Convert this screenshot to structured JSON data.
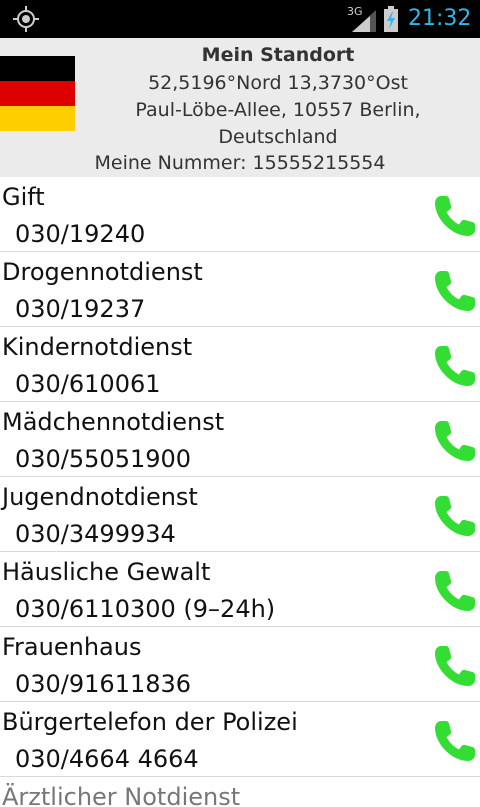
{
  "status_bar": {
    "network": "3G",
    "time": "21:32"
  },
  "header": {
    "title": "Mein Standort",
    "coordinates": "52,5196°Nord 13,3730°Ost",
    "address_line1": "Paul-Löbe-Allee, 10557 Berlin,",
    "address_line2": "Deutschland",
    "my_number": "Meine Nummer: 15555215554",
    "flag_colors": [
      "#000000",
      "#dd0000",
      "#ffce00"
    ]
  },
  "accent_colors": {
    "call_icon": "#33dd33",
    "clock": "#33b5e5"
  },
  "contacts": [
    {
      "name": "Gift",
      "number": "030/19240"
    },
    {
      "name": "Drogennotdienst",
      "number": "030/19237"
    },
    {
      "name": "Kindernotdienst",
      "number": "030/610061"
    },
    {
      "name": "Mädchennotdienst",
      "number": "030/55051900"
    },
    {
      "name": "Jugendnotdienst",
      "number": "030/3499934"
    },
    {
      "name": "Häusliche Gewalt",
      "number": "030/6110300 (9–24h)"
    },
    {
      "name": "Frauenhaus",
      "number": "030/91611836"
    },
    {
      "name": "Bürgertelefon der Polizei",
      "number": "030/4664 4664"
    },
    {
      "name": "Ärztlicher Notdienst",
      "number": ""
    }
  ]
}
